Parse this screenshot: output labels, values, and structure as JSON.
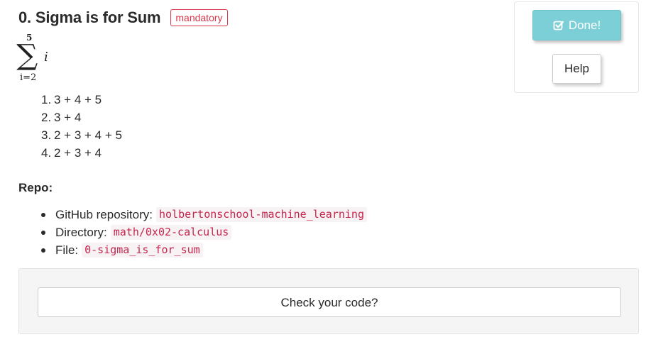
{
  "task": {
    "title": "0. Sigma is for Sum",
    "badge": "mandatory"
  },
  "formula": {
    "upper_limit": "5",
    "symbol": "∑",
    "variable": "i",
    "lower_limit": "i=2"
  },
  "options": [
    {
      "number": "1.",
      "text": "3 + 4 + 5"
    },
    {
      "number": "2.",
      "text": "3 + 4"
    },
    {
      "number": "3.",
      "text": "2 + 3 + 4 + 5"
    },
    {
      "number": "4.",
      "text": "2 + 3 + 4"
    }
  ],
  "repo": {
    "heading": "Repo:",
    "items": [
      {
        "label": "GitHub repository:",
        "value": "holbertonschool-machine_learning"
      },
      {
        "label": "Directory:",
        "value": "math/0x02-calculus"
      },
      {
        "label": "File:",
        "value": "0-sigma_is_for_sum"
      }
    ]
  },
  "check": {
    "button_label": "Check your code?"
  },
  "side_panel": {
    "done_label": "Done!",
    "done_icon": "check-square-icon",
    "help_label": "Help"
  },
  "colors": {
    "badge_red": "#d9364b",
    "code_red": "#c7254e",
    "done_teal": "#7ccfd6"
  }
}
